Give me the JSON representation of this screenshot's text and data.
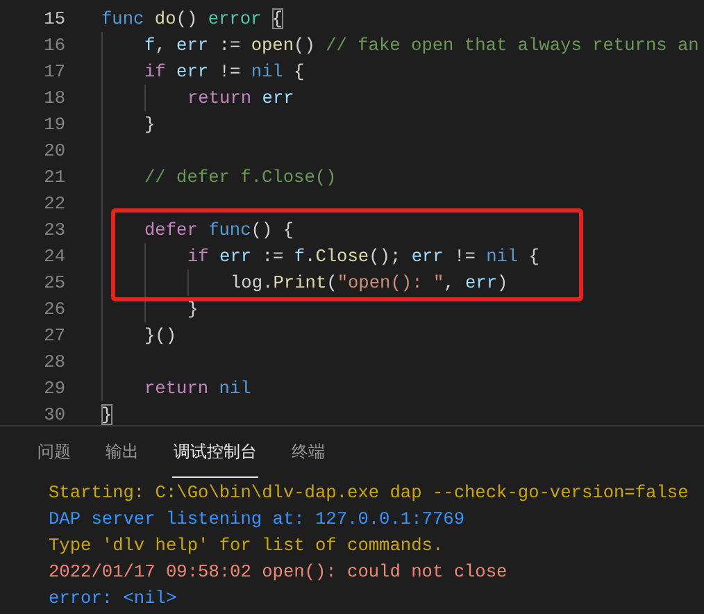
{
  "editor": {
    "lines": [
      {
        "number": "15",
        "current": true,
        "highlighted": false,
        "tokens": [
          {
            "text": "func ",
            "kind": "keyword"
          },
          {
            "text": "do",
            "kind": "function"
          },
          {
            "text": "() ",
            "kind": "plain"
          },
          {
            "text": "error ",
            "kind": "type"
          },
          {
            "text": "{",
            "kind": "bracket-match"
          }
        ]
      },
      {
        "number": "16",
        "current": false,
        "highlighted": false,
        "tokens": [
          {
            "text": "    f",
            "kind": "variable"
          },
          {
            "text": ", ",
            "kind": "plain"
          },
          {
            "text": "err",
            "kind": "variable"
          },
          {
            "text": " := ",
            "kind": "plain"
          },
          {
            "text": "open",
            "kind": "function"
          },
          {
            "text": "() ",
            "kind": "plain"
          },
          {
            "text": "// fake open that always returns an",
            "kind": "comment"
          }
        ]
      },
      {
        "number": "17",
        "current": false,
        "highlighted": false,
        "tokens": [
          {
            "text": "    if ",
            "kind": "control"
          },
          {
            "text": "err",
            "kind": "variable"
          },
          {
            "text": " != ",
            "kind": "plain"
          },
          {
            "text": "nil",
            "kind": "keyword"
          },
          {
            "text": " {",
            "kind": "plain"
          }
        ]
      },
      {
        "number": "18",
        "current": false,
        "highlighted": false,
        "tokens": [
          {
            "text": "        return ",
            "kind": "control"
          },
          {
            "text": "err",
            "kind": "variable"
          }
        ]
      },
      {
        "number": "19",
        "current": false,
        "highlighted": false,
        "tokens": [
          {
            "text": "    }",
            "kind": "plain"
          }
        ]
      },
      {
        "number": "20",
        "current": false,
        "highlighted": false
      },
      {
        "number": "21",
        "current": false,
        "highlighted": false,
        "tokens": [
          {
            "text": "    // defer f.Close()",
            "kind": "comment"
          }
        ]
      },
      {
        "number": "22",
        "current": false,
        "highlighted": false
      },
      {
        "number": "23",
        "current": false,
        "highlighted": true,
        "tokens": [
          {
            "text": "    defer ",
            "kind": "control"
          },
          {
            "text": "func",
            "kind": "keyword"
          },
          {
            "text": "() {",
            "kind": "plain"
          }
        ]
      },
      {
        "number": "24",
        "current": false,
        "highlighted": true,
        "tokens": [
          {
            "text": "        if ",
            "kind": "control"
          },
          {
            "text": "err",
            "kind": "variable"
          },
          {
            "text": " := ",
            "kind": "plain"
          },
          {
            "text": "f",
            "kind": "variable"
          },
          {
            "text": ".",
            "kind": "plain"
          },
          {
            "text": "Close",
            "kind": "function"
          },
          {
            "text": "(); ",
            "kind": "plain"
          },
          {
            "text": "err",
            "kind": "variable"
          },
          {
            "text": " != ",
            "kind": "plain"
          },
          {
            "text": "nil",
            "kind": "keyword"
          },
          {
            "text": " {",
            "kind": "plain"
          }
        ]
      },
      {
        "number": "25",
        "current": false,
        "highlighted": true,
        "tokens": [
          {
            "text": "            log",
            "kind": "plain"
          },
          {
            "text": ".",
            "kind": "plain"
          },
          {
            "text": "Print",
            "kind": "function"
          },
          {
            "text": "(",
            "kind": "plain"
          },
          {
            "text": "\"open(): \"",
            "kind": "string"
          },
          {
            "text": ", ",
            "kind": "plain"
          },
          {
            "text": "err",
            "kind": "variable"
          },
          {
            "text": ")",
            "kind": "plain"
          }
        ]
      },
      {
        "number": "26",
        "current": false,
        "highlighted": false,
        "tokens": [
          {
            "text": "        }",
            "kind": "plain"
          }
        ]
      },
      {
        "number": "27",
        "current": false,
        "highlighted": false,
        "tokens": [
          {
            "text": "    }()",
            "kind": "plain"
          }
        ]
      },
      {
        "number": "28",
        "current": false,
        "highlighted": false
      },
      {
        "number": "29",
        "current": false,
        "highlighted": false,
        "tokens": [
          {
            "text": "    return ",
            "kind": "control"
          },
          {
            "text": "nil",
            "kind": "keyword"
          }
        ]
      },
      {
        "number": "30",
        "current": false,
        "highlighted": false,
        "tokens": [
          {
            "text": "}",
            "kind": "bracket-match"
          }
        ]
      }
    ]
  },
  "panel": {
    "tabs": [
      {
        "label": "问题",
        "selected": false
      },
      {
        "label": "输出",
        "selected": false
      },
      {
        "label": "调试控制台",
        "selected": true
      },
      {
        "label": "终端",
        "selected": false
      }
    ],
    "console": [
      {
        "text": "Starting: C:\\Go\\bin\\dlv-dap.exe dap --check-go-version=false",
        "kind": "warning"
      },
      {
        "text": "DAP server listening at: 127.0.0.1:7769",
        "kind": "info"
      },
      {
        "text": "Type 'dlv help' for list of commands.",
        "kind": "warning"
      },
      {
        "text": "2022/01/17 09:58:02 open(): could not close",
        "kind": "error"
      },
      {
        "text": "error: <nil>",
        "kind": "info"
      }
    ]
  }
}
